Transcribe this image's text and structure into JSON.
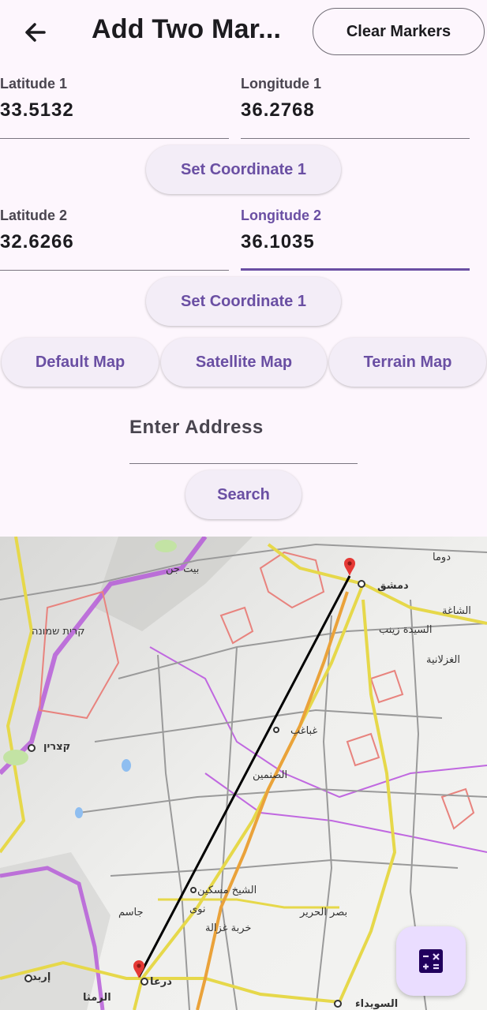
{
  "app_bar": {
    "title": "Add Two Mar...",
    "clear_button": "Clear Markers",
    "back_icon": "arrow-back-icon"
  },
  "coordinates": [
    {
      "lat_label": "Latitude 1",
      "lat_value": "33.5132",
      "lng_label": "Longitude 1",
      "lng_value": "36.2768",
      "button": "Set Coordinate 1"
    },
    {
      "lat_label": "Latitude 2",
      "lat_value": "32.6266",
      "lng_label": "Longitude 2",
      "lng_value": "36.1035",
      "button": "Set Coordinate 1",
      "focused_field": "longitude"
    }
  ],
  "map_type_buttons": [
    "Default Map",
    "Satellite Map",
    "Terrain Map"
  ],
  "address": {
    "placeholder": "Enter Address",
    "search_button": "Search"
  },
  "map": {
    "labels_arabic": [
      "دمشق",
      "دوما",
      "الشاغة",
      "السيدة زينب",
      "الغزلانية",
      "غباغب",
      "الصنمين",
      "الشيخ مسكين",
      "نوى",
      "بصر الحرير",
      "درعا",
      "الرمثا",
      "السويداء",
      "إربد",
      "بيت جن",
      "خربة غزالة",
      "جاسم"
    ],
    "labels_hebrew": [
      "קצרין",
      "קרית שמונה"
    ],
    "marker_color": "#e53935",
    "route_color": "#000000"
  },
  "fab": {
    "icon": "calculate-icon"
  },
  "colors": {
    "primary": "#6a4fa3",
    "background": "#fdf6fd",
    "fab": "#eaddff"
  }
}
